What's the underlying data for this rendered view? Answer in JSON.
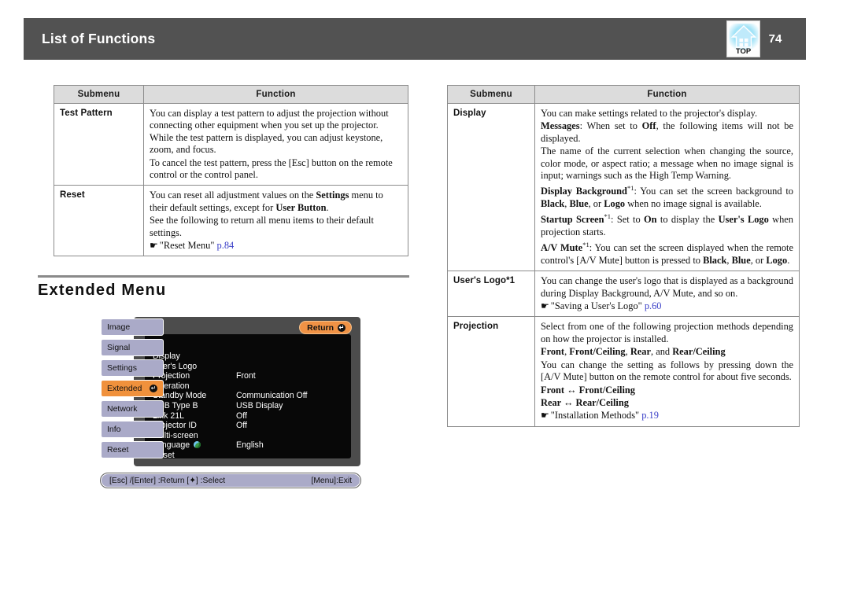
{
  "header": {
    "title": "List of Functions",
    "page_number": "74",
    "top_icon_label": "TOP",
    "bar_color": "#525252"
  },
  "left_table": {
    "columns": [
      "Submenu",
      "Function"
    ],
    "rows": [
      {
        "submenu": "Test Pattern",
        "paragraphs": [
          "You can display a test pattern to adjust the projection without connecting other equipment when you set up the projector. While the test pattern is displayed, you can adjust keystone, zoom, and focus.",
          "To cancel the test pattern, press the [Esc] button on the remote control or the control panel."
        ]
      },
      {
        "submenu": "Reset",
        "paragraphs": [
          "You can reset all adjustment values on the Settings menu to their default settings, except for User Button.",
          "See the following to return all menu items to their default settings."
        ],
        "reference": {
          "text": "\"Reset Menu\"",
          "page": "p.84"
        }
      }
    ]
  },
  "right_table": {
    "columns": [
      "Submenu",
      "Function"
    ],
    "rows": [
      {
        "submenu": "Display",
        "paragraphs": [
          "You can make settings related to the projector's display.",
          "Messages: When set to Off, the following items will not be displayed.",
          "The name of the current selection when changing the source, color mode, or aspect ratio; a message when no image signal is input; warnings such as the High Temp Warning.",
          "Display Background*1: You can set the screen background to Black, Blue, or Logo when no image signal is available.",
          "Startup Screen*1: Set to On to display the User's Logo when projection starts.",
          "A/V Mute*1: You can set the screen displayed when the remote control's [A/V Mute] button is pressed to Black, Blue, or Logo."
        ]
      },
      {
        "submenu": "User's Logo*1",
        "paragraphs": [
          "You can change the user's logo that is displayed as a background during Display Background, A/V Mute, and so on."
        ],
        "reference": {
          "text": "\"Saving a User's Logo\"",
          "page": "p.60"
        }
      },
      {
        "submenu": "Projection",
        "paragraphs": [
          "Select from one of the following projection methods depending on how the projector is installed.",
          "Front, Front/Ceiling, Rear, and Rear/Ceiling",
          "You can change the setting as follows by pressing down the [A/V Mute] button on the remote control for about five seconds.",
          "Front ↔ Front/Ceiling",
          "Rear ↔ Rear/Ceiling"
        ],
        "reference": {
          "text": "\"Installation Methods\"",
          "page": "p.19"
        }
      }
    ]
  },
  "section": {
    "title": "Extended Menu"
  },
  "osd": {
    "return_label": "Return",
    "enter_glyph": "↵",
    "sidebar_items": [
      {
        "label": "Image",
        "active": false
      },
      {
        "label": "Signal",
        "active": false
      },
      {
        "label": "Settings",
        "active": false
      },
      {
        "label": "Extended",
        "active": true
      },
      {
        "label": "Network",
        "active": false
      },
      {
        "label": "Info",
        "active": false
      },
      {
        "label": "Reset",
        "active": false
      }
    ],
    "menu_items": [
      {
        "name": "Display",
        "value": ""
      },
      {
        "name": "User's Logo",
        "value": ""
      },
      {
        "name": "Projection",
        "value": "Front"
      },
      {
        "name": "Operation",
        "value": ""
      },
      {
        "name": "Standby Mode",
        "value": "Communication Off"
      },
      {
        "name": "USB Type B",
        "value": "USB Display"
      },
      {
        "name": "Link 21L",
        "value": "Off"
      },
      {
        "name": "Projector ID",
        "value": "Off"
      },
      {
        "name": "Multi-screen",
        "value": ""
      },
      {
        "name": "Language",
        "value": "English",
        "globe": true
      },
      {
        "name": "Reset",
        "value": ""
      }
    ],
    "footer": {
      "left": "[Esc] /[Enter] :Return  [✦] :Select",
      "right": "[Menu]:Exit"
    },
    "colors": {
      "accent_orange": "#f0913c",
      "sidebar_lavender": "#aaaac8",
      "panel_black": "#080808",
      "body_gray": "#4c4c4c"
    }
  }
}
